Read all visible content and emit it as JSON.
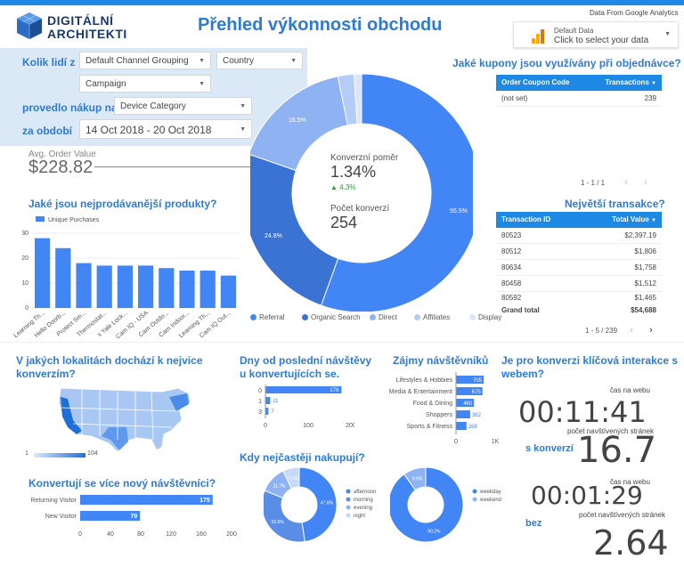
{
  "header": {
    "logo_line1": "DIGITÁLNÍ",
    "logo_line2": "ARCHITEKTI",
    "title": "Přehled výkonnosti obchodu",
    "data_source_label": "Data From Google Analytics",
    "data_selector": {
      "name": "Default Data",
      "hint": "Click to select your data"
    }
  },
  "filters": {
    "q1": "Kolik lidí z",
    "channel_grouping": "Default Channel Grouping",
    "country": "Country",
    "campaign": "Campaign",
    "q2": "provedlo nákup na",
    "device_category": "Device Category",
    "q3": "za období",
    "date_range": "14 Oct 2018 - 20 Oct 2018"
  },
  "aov": {
    "label": "Avg. Order Value",
    "value": "$228.82"
  },
  "donut": {
    "conv_rate_label": "Konverzní poměr",
    "conv_rate_value": "1.34%",
    "conv_change": "4.3%",
    "conv_count_label": "Počet konverzí",
    "conv_count_value": "254",
    "pct_labels": [
      "55.5%",
      "24.8%",
      "16.5%"
    ]
  },
  "coupons": {
    "title": "Jaké kupony jsou využívány při objednávce?",
    "col1": "Order Coupon Code",
    "col2": "Transactions",
    "rows": [
      {
        "code": "(not set)",
        "tx": "239"
      }
    ],
    "pager": "1 - 1 / 1"
  },
  "transactions": {
    "title": "Největší transakce?",
    "col1": "Transaction ID",
    "col2": "Total Value",
    "rows": [
      {
        "id": "80523",
        "val": "$2,397.19"
      },
      {
        "id": "80512",
        "val": "$1,806"
      },
      {
        "id": "80634",
        "val": "$1,758"
      },
      {
        "id": "80458",
        "val": "$1,512"
      },
      {
        "id": "80592",
        "val": "$1,465"
      }
    ],
    "grand_label": "Grand total",
    "grand_value": "$54,688",
    "pager": "1 - 5 / 239"
  },
  "products": {
    "title": "Jaké jsou nejprodávanější produkty?"
  },
  "locations": {
    "title": "V jakých lokalitách dochází k nejvice konverzím?",
    "legend_min": "1",
    "legend_max": "104"
  },
  "visitors": {
    "title": "Konvertují se více nový návštěvníci?"
  },
  "days": {
    "title": "Dny od poslední návštěvy u konvertujících se."
  },
  "interests": {
    "title": "Zájmy návštěvníků"
  },
  "whenbuy": {
    "title": "Kdy nejčastěji nakupují?"
  },
  "interaction": {
    "title": "Je pro konverzi klíčová interakce s webem?",
    "with_label": "s konverzí",
    "without_label": "bez",
    "time_label1": "čas na webu",
    "time1": "00:11:41",
    "pages_label1": "počet navštívených stránek",
    "pages1": "16.7",
    "time_label2": "čas na webu",
    "time2": "00:01:29",
    "pages_label2": "počet navštívených stránek",
    "pages2": "2.64"
  },
  "chart_data": [
    {
      "type": "pie",
      "title": "",
      "categories": [
        "Referral",
        "Organic Search",
        "Direct",
        "Affiliates",
        "Display"
      ],
      "values": [
        55.5,
        24.8,
        16.5,
        2.2,
        1.0
      ],
      "colors": [
        "#4285f4",
        "#3a73d4",
        "#8fb3f2",
        "#b4cdf6",
        "#d9e5fb"
      ]
    },
    {
      "type": "bar",
      "title": "",
      "legend": "Unique Purchases",
      "categories": [
        "Learning Th...",
        "Hello Doorb...",
        "Protect Sm...",
        "Thermostat...",
        "x Yale Lock...",
        "Cam IQ - USA",
        "Cam Outdo...",
        "Cam Indoor...",
        "Learning Th...",
        "Cam IQ Out..."
      ],
      "values": [
        28,
        24,
        18,
        17,
        17,
        17,
        16,
        15,
        15,
        13
      ],
      "ylim": [
        0,
        30
      ],
      "yticks": [
        0,
        10,
        20,
        30
      ]
    },
    {
      "type": "bar",
      "orientation": "horizontal",
      "categories": [
        "Returning Visitor",
        "New Visitor"
      ],
      "values": [
        175,
        79
      ],
      "xlim": [
        0,
        200
      ],
      "xticks": [
        0,
        40,
        80,
        120,
        160,
        200
      ]
    },
    {
      "type": "bar",
      "orientation": "horizontal",
      "categories": [
        "0",
        "1",
        "3"
      ],
      "values": [
        178,
        11,
        7
      ],
      "xlim": [
        0,
        200
      ],
      "xticks": [
        0,
        100,
        200
      ]
    },
    {
      "type": "bar",
      "orientation": "horizontal",
      "categories": [
        "Lifestyles & Hobbies",
        "Media & Entertainment",
        "Food & Dining",
        "Shoppers",
        "Sports & Fitness"
      ],
      "values": [
        705,
        675,
        460,
        362,
        268
      ],
      "xlim": [
        0,
        1000
      ],
      "xticks": [
        "0",
        "1K"
      ]
    },
    {
      "type": "pie",
      "categories": [
        "afternoon",
        "morning",
        "evening",
        "night"
      ],
      "values": [
        47.6,
        33.6,
        11.7,
        7.1
      ],
      "labels": [
        "47.6%",
        "33.6%",
        "11.7%",
        "7.1%"
      ],
      "colors": [
        "#4285f4",
        "#5a8ee6",
        "#8fb3f2",
        "#c7d9f8"
      ]
    },
    {
      "type": "pie",
      "categories": [
        "weekday",
        "weekend"
      ],
      "values": [
        90.2,
        9.8
      ],
      "labels": [
        "90.2%",
        "9.8%"
      ],
      "colors": [
        "#4285f4",
        "#8fb3f2"
      ]
    }
  ]
}
